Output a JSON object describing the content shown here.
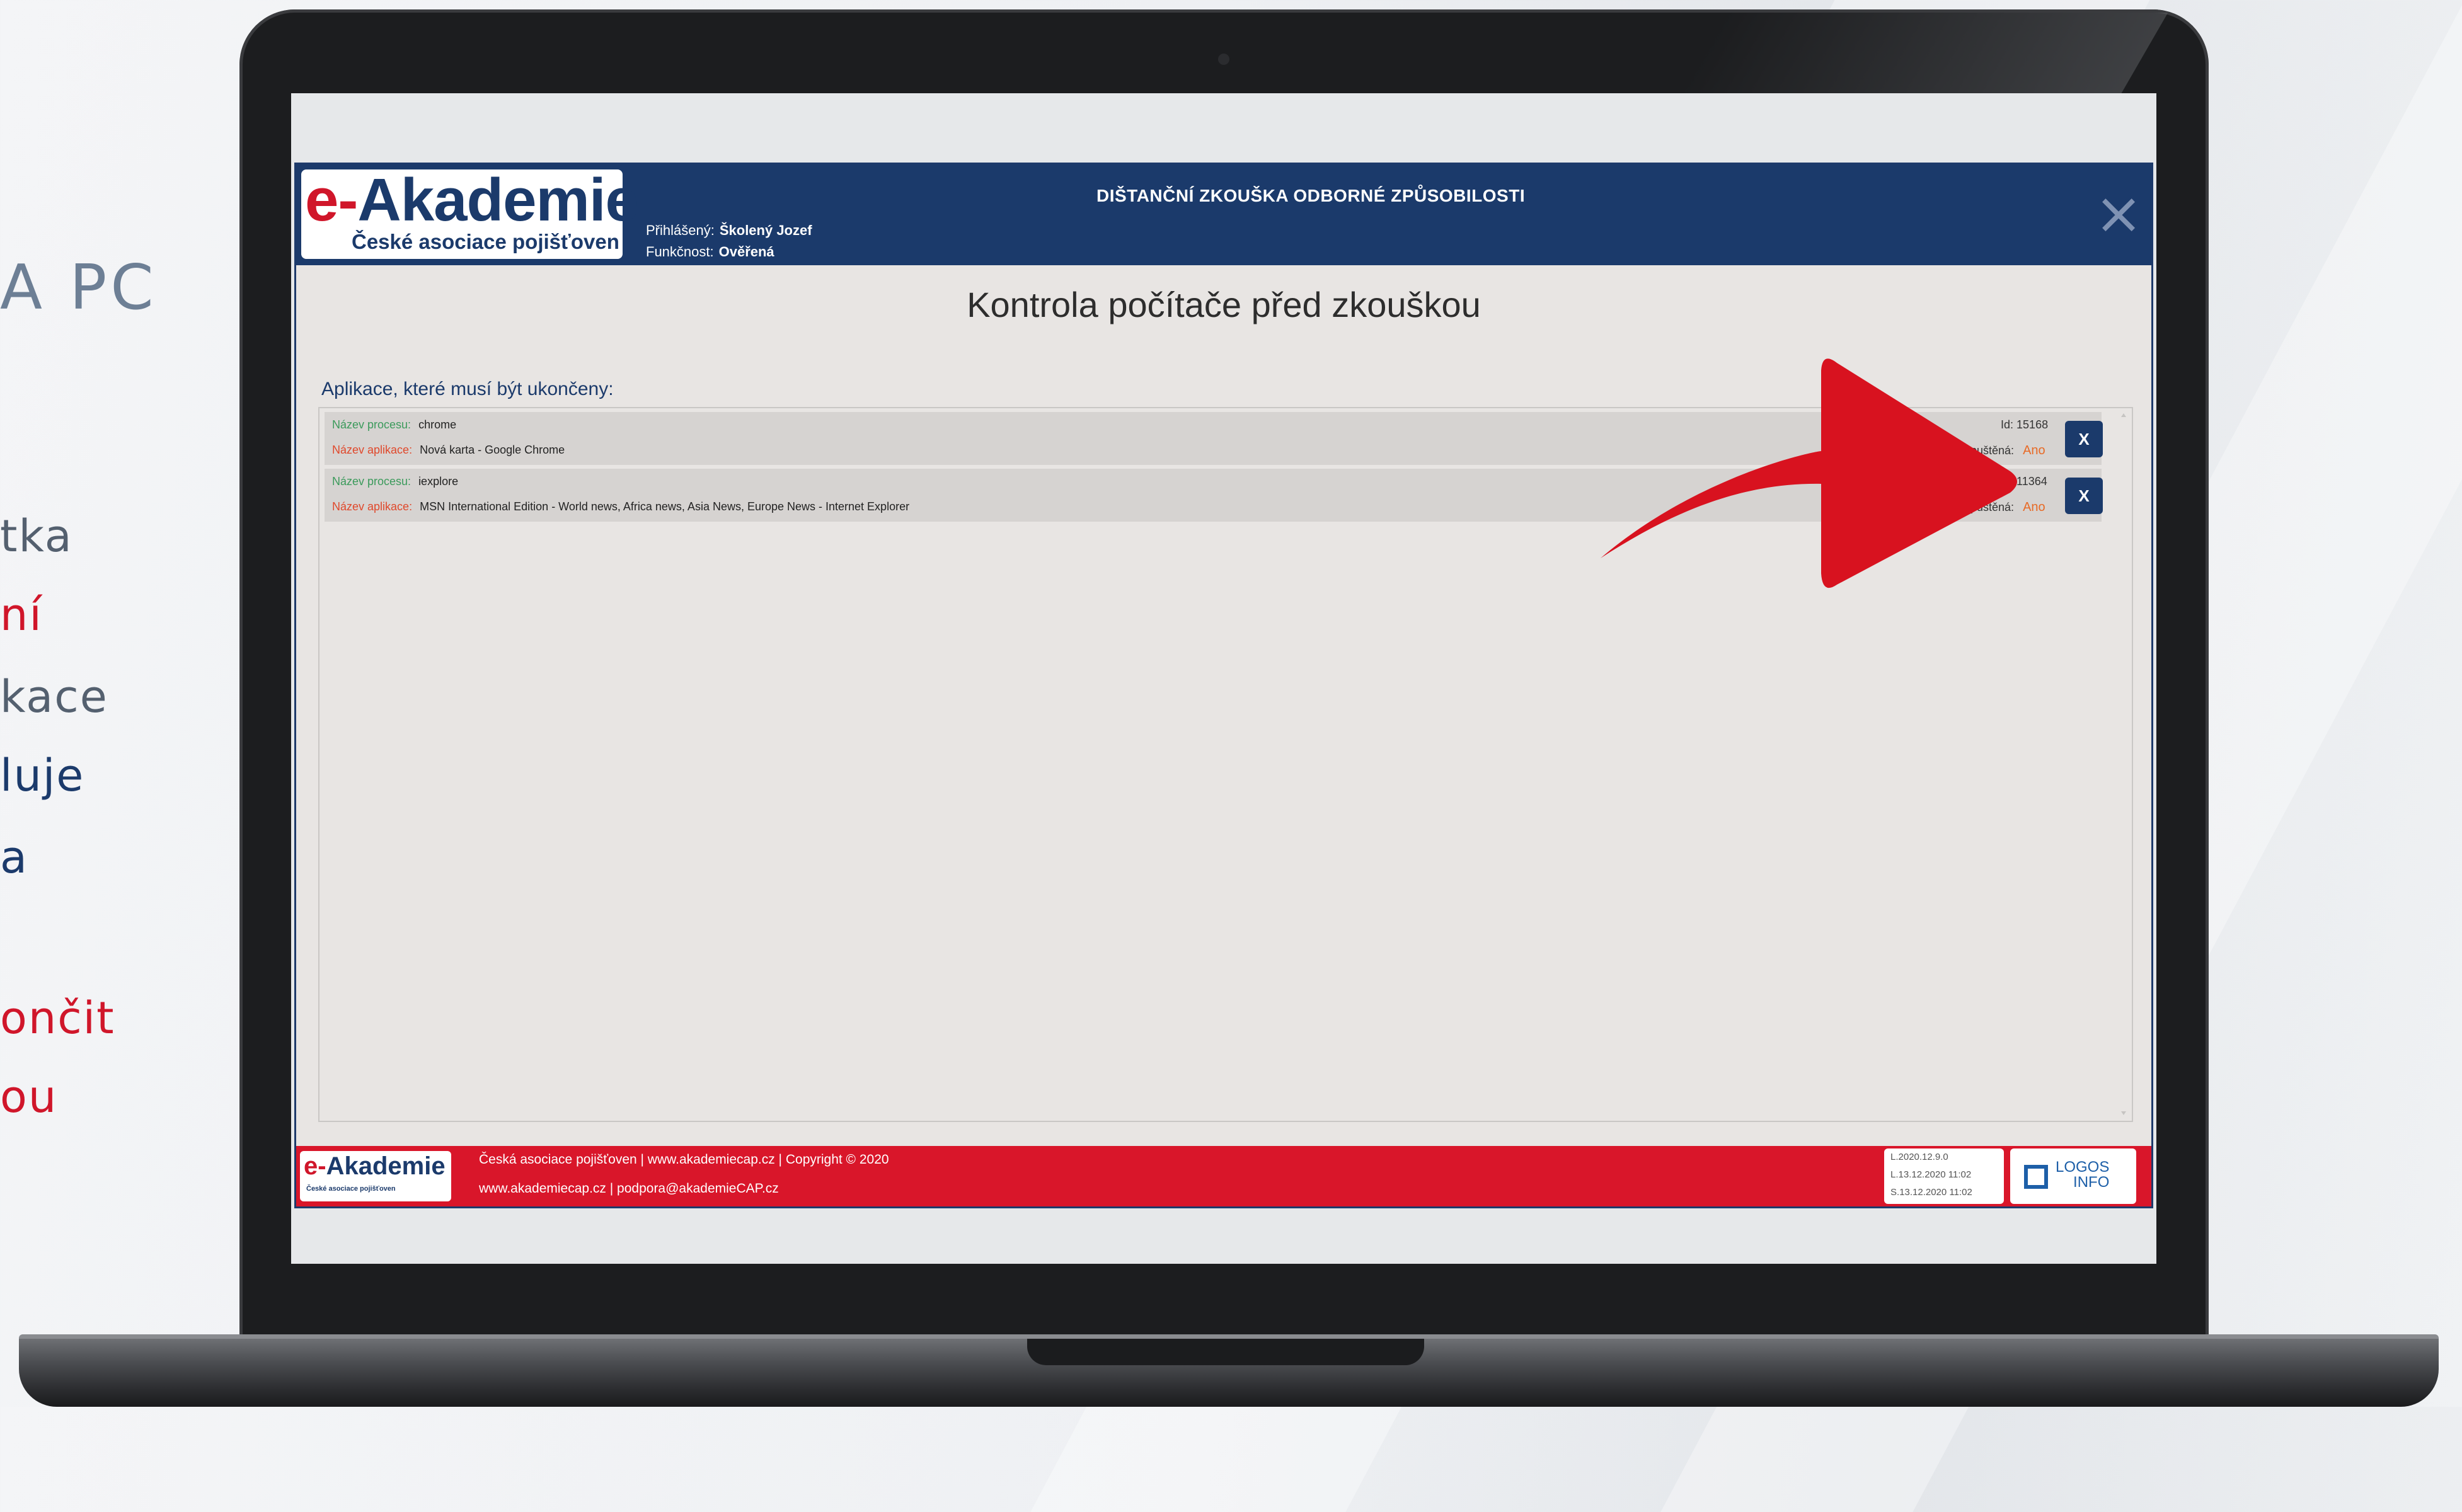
{
  "sidebar": {
    "title": "A PC",
    "lines": [
      {
        "text": "tka",
        "color": "#54606f"
      },
      {
        "text": "ní",
        "color": "#d0162a"
      },
      {
        "text": "kace",
        "color": "#54606f"
      },
      {
        "text": "luje",
        "color": "#1b3a6b"
      },
      {
        "text": "a",
        "color": "#1b3a6b"
      },
      {
        "text": "ončit",
        "color": "#d0162a"
      },
      {
        "text": "ou",
        "color": "#d0162a"
      }
    ]
  },
  "header": {
    "logo_prefix": "e-",
    "logo_name": "Akademie",
    "logo_sub": "České asociace pojišťoven",
    "login_label": "Přihlášený:",
    "login_user": "Školený Jozef",
    "function_label": "Funkčnost:",
    "function_value": "Ověřená",
    "title": "DIŠTANČNÍ ZKOUŠKA ODBORNÉ ZPŮSOBILOSTI",
    "close_icon": "×"
  },
  "main": {
    "page_title": "Kontrola počítače před zkouškou",
    "section_label": "Aplikace, které musí být ukončeny:",
    "process_label": "Název procesu:",
    "app_label": "Název aplikace:",
    "id_label": "Id:",
    "running_label": "Spuštěná:",
    "kill_label": "X",
    "processes": [
      {
        "process": "chrome",
        "app": "Nová karta - Google Chrome",
        "id": "15168",
        "running": "Ano"
      },
      {
        "process": "iexplore",
        "app": "MSN International Edition - World news, Africa news, Asia News, Europe News - Internet Explorer",
        "id": "11364",
        "running": "Ano"
      }
    ]
  },
  "footer": {
    "logo_prefix": "e-",
    "logo_name": "Akademie",
    "logo_sub": "České asociace pojišťoven",
    "line1": "Česká asociace pojišťoven | www.akademiecap.cz | Copyright © 2020",
    "line2": "www.akademiecap.cz | podpora@akademieCAP.cz",
    "versions": [
      "L.2020.12.9.0",
      "L.13.12.2020 11:02",
      "S.13.12.2020 11:02"
    ],
    "partner_line1": "LOGOS",
    "partner_line2": "INFO"
  },
  "colors": {
    "brand_blue": "#1b3a6b",
    "brand_red": "#d9162a",
    "arrow_red": "#d8121f",
    "running_orange": "#e86a26"
  }
}
